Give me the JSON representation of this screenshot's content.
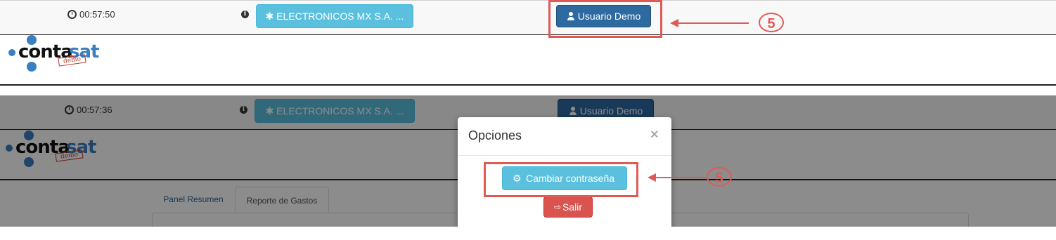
{
  "top": {
    "timer": "00:57:50",
    "company_button": "✱ ELECTRONICOS MX S.A. ...",
    "user_button": "Usuario Demo",
    "callout_number": "5"
  },
  "logo": {
    "text_black": "conta",
    "text_blue": "sat",
    "stamp": "demo"
  },
  "bottom": {
    "timer": "00:57:36",
    "company_button": "✱ ELECTRONICOS MX S.A. ...",
    "user_button": "Usuario Demo",
    "tabs": [
      {
        "label": "Panel Resumen"
      },
      {
        "label": "Reporte de Gastos"
      }
    ],
    "callout_number": "5"
  },
  "modal": {
    "title": "Opciones",
    "close": "×",
    "change_password": "Cambiar contraseña",
    "logout": "Salir"
  },
  "colors": {
    "accent_red": "#e05a55",
    "info": "#5bc0de",
    "primary": "#2c6aa0",
    "danger": "#d9534f"
  }
}
